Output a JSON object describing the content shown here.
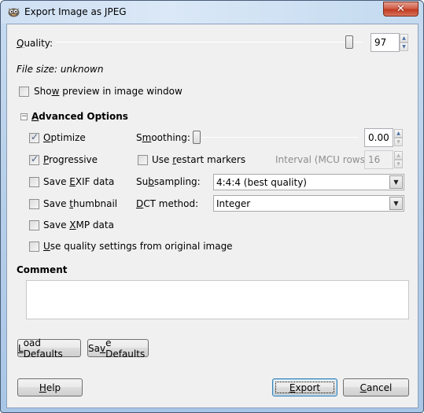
{
  "window": {
    "title": "Export Image as JPEG",
    "close_label": "✕"
  },
  "quality": {
    "label_prefix": "",
    "label_accel": "Q",
    "label_rest": "uality:",
    "value": "97",
    "slider_fraction": 0.97
  },
  "file_size": "File size: unknown",
  "show_preview": {
    "label_pre": "Sho",
    "label_accel": "w",
    "label_post": " preview in image window",
    "checked": false
  },
  "advanced": {
    "expander_glyph": "−",
    "title_accel": "A",
    "title_rest": "dvanced Options",
    "optimize": {
      "pre": "",
      "accel": "O",
      "post": "ptimize",
      "checked": true
    },
    "progressive": {
      "pre": "",
      "accel": "P",
      "post": "rogressive",
      "checked": true
    },
    "save_exif": {
      "pre": "Save ",
      "accel": "E",
      "post": "XIF data",
      "checked": false
    },
    "save_thumbnail": {
      "pre": "Save ",
      "accel": "t",
      "post": "humbnail",
      "checked": false
    },
    "save_xmp": {
      "pre": "Save ",
      "accel": "X",
      "post": "MP data",
      "checked": false
    },
    "use_quality": {
      "pre": "",
      "accel": "U",
      "post": "se quality settings from original image",
      "checked": false
    },
    "smoothing": {
      "pre": "S",
      "accel": "m",
      "post": "oothing:",
      "value": "0.00",
      "slider_fraction": 0.0
    },
    "restart_markers": {
      "pre": "Use ",
      "accel": "r",
      "post": "estart markers",
      "checked": false
    },
    "interval": {
      "label": "Interval (MCU rows):",
      "value": "16"
    },
    "subsampling": {
      "pre": "Su",
      "accel": "b",
      "post": "sampling:",
      "value": "4:4:4 (best quality)"
    },
    "dct_method": {
      "pre": "",
      "accel": "D",
      "post": "CT method:",
      "value": "Integer"
    }
  },
  "comment": {
    "label": "Comment",
    "value": ""
  },
  "buttons": {
    "load_defaults": {
      "pre": "",
      "accel": "L",
      "post": "oad Defaults"
    },
    "save_defaults": {
      "pre": "Sa",
      "accel": "v",
      "post": "e Defaults"
    },
    "help": {
      "pre": "",
      "accel": "H",
      "post": "elp"
    },
    "export": {
      "pre": "",
      "accel": "E",
      "post": "xport"
    },
    "cancel": {
      "pre": "",
      "accel": "C",
      "post": "ancel"
    }
  },
  "icons": {
    "check": "✓",
    "spin_up": "▲",
    "spin_down": "▼",
    "combo_arrow": "▼"
  }
}
